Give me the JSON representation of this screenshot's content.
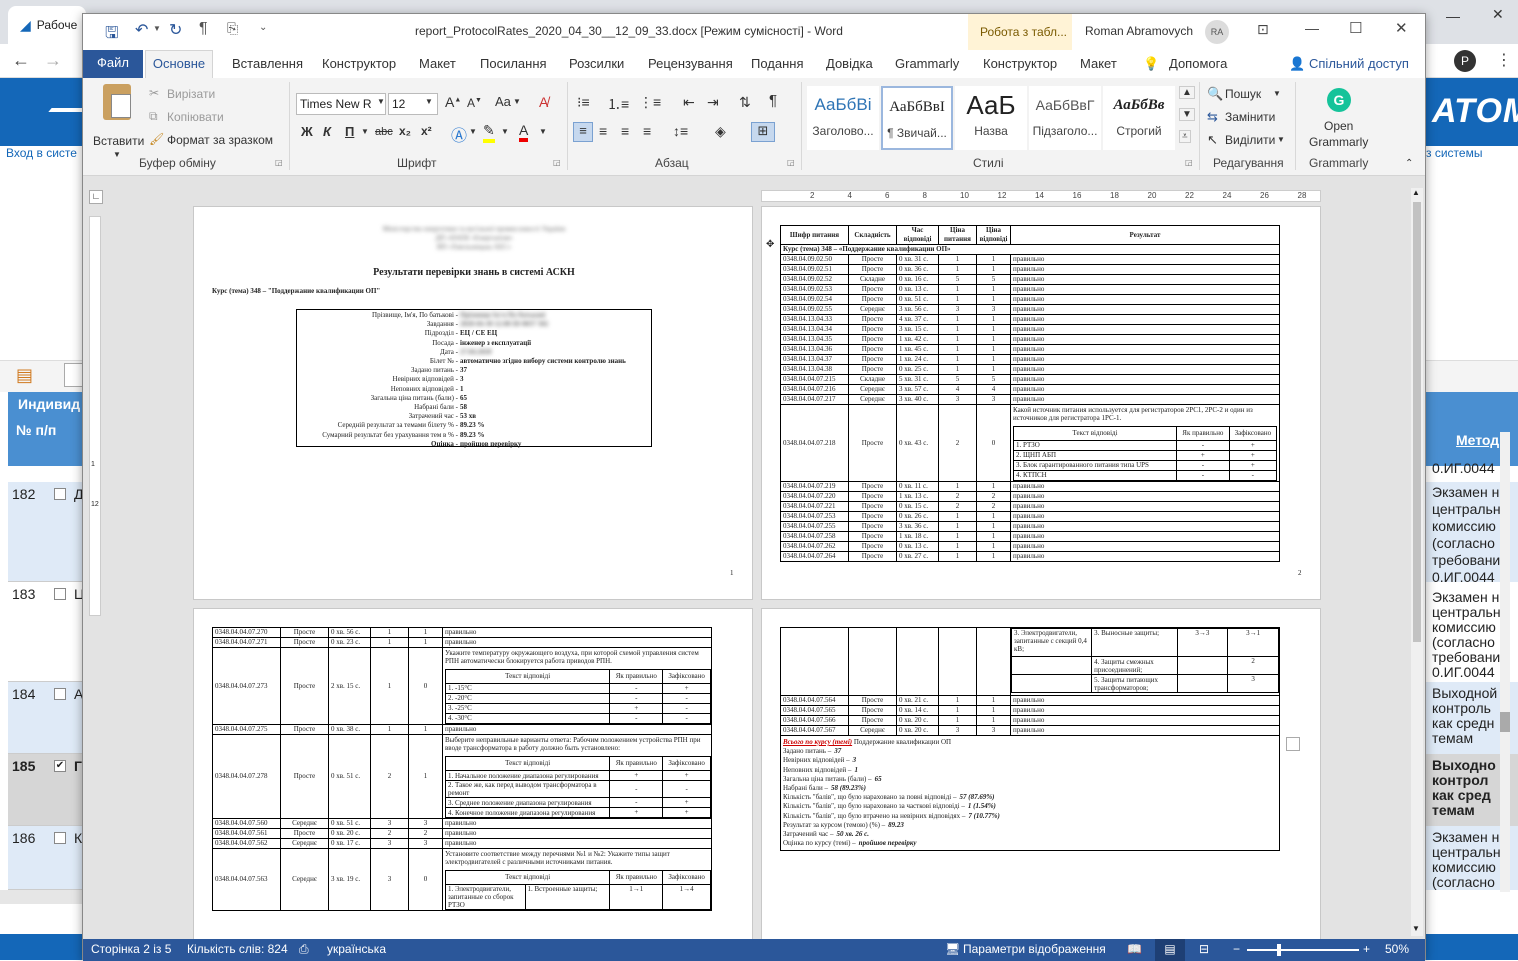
{
  "browser": {
    "tab_label": "Рабоче",
    "left_link": "Вход в систе",
    "right_link": "з системы",
    "banner_logo": "АТОМ",
    "avatar_letter": "P",
    "table_header_left": "Индивид",
    "col_num": "№ п/п",
    "col_method": "Методи",
    "rows": [
      {
        "num": "182",
        "right": [
          "0.ИГ.0044",
          "Экзамен н",
          "центральн",
          "комиссию",
          "(согласно",
          "требовани",
          "0.ИГ.0044"
        ],
        "letter": "Д"
      },
      {
        "num": "183",
        "right": [
          "Экзамен н",
          "центральн",
          "комиссию",
          "(согласно",
          "требовани",
          "0.ИГ.0044"
        ],
        "letter": "Ц"
      },
      {
        "num": "184",
        "right": [
          "Выходной",
          "контроль",
          "как средн",
          "темам"
        ],
        "letter": "А"
      },
      {
        "num": "185",
        "right": [
          "Выходно",
          "контрол",
          "как сред",
          "темам"
        ],
        "letter": "Г",
        "bold": true
      },
      {
        "num": "186",
        "right": [
          "Экзамен н",
          "центральн",
          "комиссию",
          "(согласно"
        ],
        "letter": "К"
      }
    ]
  },
  "word": {
    "title": "report_ProtocolRates_2020_04_30__12_09_33.docx [Режим сумісності]  -  Word",
    "context_tab": "Робота з табл...",
    "user": "Roman Abramovych",
    "user_initials": "RA",
    "tabs": {
      "file": "Файл",
      "home": "Основне",
      "insert": "Вставлення",
      "design": "Конструктор",
      "layout": "Макет",
      "references": "Посилання",
      "mailings": "Розсилки",
      "review": "Рецензування",
      "view": "Подання",
      "help": "Довідка",
      "grammarly": "Grammarly",
      "tdesign": "Конструктор",
      "tlayout": "Макет",
      "tellme": "Допомога",
      "share": "Спільний доступ"
    },
    "clipboard": {
      "paste": "Вставити",
      "cut": "Вирізати",
      "copy": "Копіювати",
      "format_painter": "Формат за зразком",
      "label": "Буфер обміну"
    },
    "font": {
      "name": "Times New R",
      "size": "12",
      "label": "Шрифт",
      "bold": "Ж",
      "italic": "К",
      "underline": "П",
      "strike": "abc",
      "sub": "x₂",
      "sup": "x²",
      "case": "Aa"
    },
    "paragraph": {
      "label": "Абзац"
    },
    "styles": {
      "label": "Стилі",
      "items": [
        {
          "preview": "АаБбВі",
          "name": "Заголово..."
        },
        {
          "preview": "АаБбВвІ",
          "name": "¶ Звичай..."
        },
        {
          "preview": "АаБ",
          "name": "Назва"
        },
        {
          "preview": "АаБбВвГ",
          "name": "Підзаголо..."
        },
        {
          "preview": "АаБбВв",
          "name": "Строгий"
        }
      ]
    },
    "editing": {
      "find": "Пошук",
      "replace": "Замінити",
      "select": "Виділити",
      "label": "Редагування"
    },
    "grammarly_group": {
      "open": "Open",
      "name": "Grammarly",
      "label": "Grammarly"
    },
    "ruler_marks": [
      "2",
      "4",
      "6",
      "8",
      "10",
      "12",
      "14",
      "16",
      "18",
      "20",
      "22",
      "24",
      "26",
      "28"
    ],
    "status": {
      "page": "Сторінка 2 із 5",
      "words": "Кількість слів: 824",
      "lang": "українська",
      "display": "Параметри відображення",
      "zoom": "50%"
    }
  },
  "doc": {
    "p1": {
      "heading": "Результати перевірки знань в системі АСКН",
      "course": "Курс (тема) 348 – \"Поддержание квалификации ОП\"",
      "blur_lines": [
        "Міністерство енергетики та вугільної промисловості України",
        "ДП «НАЕК «Енергоатом»",
        "ВП «Хмельницька АЕС»"
      ],
      "fields": [
        {
          "k": "Прізвище, Ім'я, По батькові -",
          "v": "Прізвище Ім'я По батькові",
          "blur": true
        },
        {
          "k": "Завдання -",
          "v": "2020-04-30 12:00 ID 0037 502",
          "blur": true
        },
        {
          "k": "Підрозділ -",
          "v": "ЕЦ / СЕ ЕЦ"
        },
        {
          "k": "Посада -",
          "v": "інженер з експлуатації",
          "blur_part": true
        },
        {
          "k": "Дата -",
          "v": "27.04.2020",
          "blur": true
        },
        {
          "k": "Білет № -",
          "v": "автоматично згідно вибору системи контролю знань"
        },
        {
          "k": "Задано питань -",
          "v": "37"
        },
        {
          "k": "Невірних відповідей -",
          "v": "3"
        },
        {
          "k": "Неповних відповідей -",
          "v": "1"
        },
        {
          "k": "Загальна ціна питань (бали) -",
          "v": "65"
        },
        {
          "k": "Набрані бали -",
          "v": "58"
        },
        {
          "k": "Затрачений час -",
          "v": "53 хв"
        },
        {
          "k": "Середній результат за темами білету % -",
          "v": "89.23 %"
        },
        {
          "k": "Сумарний результат без урахування тем в % -",
          "v": "89.23 %"
        },
        {
          "k": "Оцінка -",
          "v": "пройшов перевірку"
        }
      ],
      "page_num": "1"
    },
    "p2": {
      "headers": [
        "Шифр питання",
        "Складність",
        "Час відповіді",
        "Ціна питання",
        "Ціна відповіді",
        "Результат"
      ],
      "course_row": "Курс (тема) 348 – «Поддержание квалификации ОП»",
      "rows": [
        [
          "0348.04.09.02.50",
          "Просте",
          "0 хв. 31 с.",
          "1",
          "1",
          "правильно"
        ],
        [
          "0348.04.09.02.51",
          "Просте",
          "0 хв. 36 с.",
          "1",
          "1",
          "правильно"
        ],
        [
          "0348.04.09.02.52",
          "Складне",
          "0 хв. 16 с.",
          "5",
          "5",
          "правильно"
        ],
        [
          "0348.04.09.02.53",
          "Просте",
          "0 хв. 13 с.",
          "1",
          "1",
          "правильно"
        ],
        [
          "0348.04.09.02.54",
          "Просте",
          "0 хв. 51 с.",
          "1",
          "1",
          "правильно"
        ],
        [
          "0348.04.09.02.55",
          "Середнє",
          "3 хв. 56 с.",
          "3",
          "3",
          "правильно"
        ],
        [
          "0348.04.13.04.33",
          "Просте",
          "4 хв. 37 с.",
          "1",
          "1",
          "правильно"
        ],
        [
          "0348.04.13.04.34",
          "Просте",
          "3 хв. 15 с.",
          "1",
          "1",
          "правильно"
        ],
        [
          "0348.04.13.04.35",
          "Просте",
          "1 хв. 42 с.",
          "1",
          "1",
          "правильно"
        ],
        [
          "0348.04.13.04.36",
          "Просте",
          "1 хв. 45 с.",
          "1",
          "1",
          "правильно"
        ],
        [
          "0348.04.13.04.37",
          "Просте",
          "1 хв. 24 с.",
          "1",
          "1",
          "правильно"
        ],
        [
          "0348.04.13.04.38",
          "Просте",
          "0 хв. 25 с.",
          "1",
          "1",
          "правильно"
        ],
        [
          "0348.04.04.07.215",
          "Складне",
          "5 хв. 31 с.",
          "5",
          "5",
          "правильно"
        ],
        [
          "0348.04.04.07.216",
          "Середнє",
          "3 хв. 57 с.",
          "4",
          "4",
          "правильно"
        ],
        [
          "0348.04.04.07.217",
          "Середнє",
          "3 хв. 40 с.",
          "3",
          "3",
          "правильно"
        ]
      ],
      "q_row": [
        "0348.04.04.07.218",
        "Просте",
        "0 хв. 43 с.",
        "2",
        "0"
      ],
      "q_text": "Какой источник питания используется для регистраторов 2РС1, 2РС-2 и один из источников для регистратора 1РС-1.",
      "q_sub_headers": [
        "Текст відповіді",
        "Як правильно",
        "Зафіксовано"
      ],
      "q_answers": [
        [
          "1. РТЗО",
          "-",
          "+"
        ],
        [
          "2. ЩНП АБП",
          "+",
          "+"
        ],
        [
          "3. Блок гарантированного питания типа UPS",
          "-",
          "+"
        ],
        [
          "4. КТПСН",
          "-",
          "-"
        ]
      ],
      "rows2": [
        [
          "0348.04.04.07.219",
          "Просте",
          "0 хв. 11 с.",
          "1",
          "1",
          "правильно"
        ],
        [
          "0348.04.04.07.220",
          "Просте",
          "1 хв. 13 с.",
          "2",
          "2",
          "правильно"
        ],
        [
          "0348.04.04.07.221",
          "Просте",
          "0 хв. 15 с.",
          "2",
          "2",
          "правильно"
        ],
        [
          "0348.04.04.07.253",
          "Просте",
          "0 хв. 26 с.",
          "1",
          "1",
          "правильно"
        ],
        [
          "0348.04.04.07.255",
          "Просте",
          "3 хв. 36 с.",
          "1",
          "1",
          "правильно"
        ],
        [
          "0348.04.04.07.258",
          "Просте",
          "1 хв. 18 с.",
          "1",
          "1",
          "правильно"
        ],
        [
          "0348.04.04.07.262",
          "Просте",
          "0 хв. 13 с.",
          "1",
          "1",
          "правильно"
        ],
        [
          "0348.04.04.07.264",
          "Просте",
          "0 хв. 27 с.",
          "1",
          "1",
          "правильно"
        ]
      ],
      "page_num": "2"
    },
    "p3": {
      "rows_a": [
        [
          "0348.04.04.07.270",
          "Просте",
          "0 хв. 56 с.",
          "1",
          "1",
          "правильно"
        ],
        [
          "0348.04.04.07.271",
          "Просте",
          "0 хв. 23 с.",
          "1",
          "1",
          "правильно"
        ]
      ],
      "q1_row": [
        "0348.04.04.07.273",
        "Просте",
        "2 хв. 15 с.",
        "1",
        "0"
      ],
      "q1_text": "Укажите температуру окружающего воздуха, при которой схемой управления систем РПН автоматически блокируется работа приводов РПН.",
      "sub_headers": [
        "Текст відповіді",
        "Як правильно",
        "Зафіксовано"
      ],
      "q1_answers": [
        [
          "1. -15°С",
          "-",
          "+"
        ],
        [
          "2. -20°С",
          "-",
          "-"
        ],
        [
          "3. -25°С",
          "+",
          "-"
        ],
        [
          "4. -30°С",
          "-",
          "-"
        ]
      ],
      "row_b": [
        "0348.04.04.07.275",
        "Просте",
        "0 хв. 38 с.",
        "1",
        "1",
        "правильно"
      ],
      "q2_row": [
        "0348.04.04.07.278",
        "Просте",
        "0 хв. 51 с.",
        "2",
        "1"
      ],
      "q2_text": "Выберите неправильные варианты ответа: Рабочим положением устройства РПН при вводе трансформатора в работу должно быть установлено:",
      "q2_answers": [
        [
          "1. Начальное положение диапазона регулирования",
          "+",
          "+"
        ],
        [
          "2. Такое же, как перед выводом трансформатора в ремонт",
          "-",
          "-"
        ],
        [
          "3. Среднее положение диапазона регулирования",
          "-",
          "+"
        ],
        [
          "4. Конечное положение диапазона регулирования",
          "+",
          "+"
        ]
      ],
      "rows_c": [
        [
          "0348.04.04.07.560",
          "Середнє",
          "0 хв. 51 с.",
          "3",
          "3",
          "правильно"
        ],
        [
          "0348.04.04.07.561",
          "Просте",
          "0 хв. 20 с.",
          "2",
          "2",
          "правильно"
        ],
        [
          "0348.04.04.07.562",
          "Середнє",
          "0 хв. 17 с.",
          "3",
          "3",
          "правильно"
        ]
      ],
      "q3_row": [
        "0348.04.04.07.563",
        "Середнє",
        "3 хв. 19 с.",
        "3",
        "0"
      ],
      "q3_text": "Установите соответствие между перечнями №1 и №2: Укажите типы защит электродвигателей с различными источниками питания.",
      "q3_first": [
        "1. Электродвигатели, запитанные со сборок РТЗО",
        "1. Встроенные защиты;",
        "1→1",
        "1→4"
      ]
    },
    "p4": {
      "top_rows": [
        [
          "3. Электродвигатели, запитанные с секций 0,4 кВ;",
          "3. Выносные защиты;",
          "3→3",
          "3→1"
        ],
        [
          "",
          "4. Защиты смежных присоединений;",
          "",
          "2"
        ],
        [
          "",
          "5. Защиты питающих трансформаторов;",
          "",
          "3"
        ]
      ],
      "rows": [
        [
          "0348.04.04.07.564",
          "Просте",
          "0 хв. 21 с.",
          "1",
          "1",
          "правильно"
        ],
        [
          "0348.04.04.07.565",
          "Просте",
          "0 хв. 14 с.",
          "1",
          "1",
          "правильно"
        ],
        [
          "0348.04.04.07.566",
          "Просте",
          "0 хв. 20 с.",
          "1",
          "1",
          "правильно"
        ],
        [
          "0348.04.04.07.567",
          "Середнє",
          "0 хв. 20 с.",
          "3",
          "3",
          "правильно"
        ]
      ],
      "summary_red": "Всього по курсу (темі)",
      "summary_title": " Поддержание квалификации ОП",
      "summary": [
        {
          "k": "Задано питань –",
          "v": "37"
        },
        {
          "k": "Невірних відповідей –",
          "v": "3"
        },
        {
          "k": "Неповних відповідей –",
          "v": "1"
        },
        {
          "k": "Загальна ціна питань (бали) –",
          "v": "65"
        },
        {
          "k": "Набрані бали –",
          "v": "58 (89.23%)"
        },
        {
          "k": "Кількість \"балів\", що було нараховано за повні відповіді –",
          "v": "57  (87.69%)"
        },
        {
          "k": "Кількість \"балів\", що було нараховано за часткові відповіді –",
          "v": "1  (1.54%)"
        },
        {
          "k": "Кількість \"балів\", що було втрачено на невірних відповідях –",
          "v": "7  (10.77%)"
        },
        {
          "k": "Результат за курсом (темою) (%) –",
          "v": "89.23"
        },
        {
          "k": "Затрачений час –",
          "v": "50 хв. 26 с."
        },
        {
          "k": "Оцінка по курсу (темі) –",
          "v": "пройшов перевірку"
        }
      ]
    }
  }
}
